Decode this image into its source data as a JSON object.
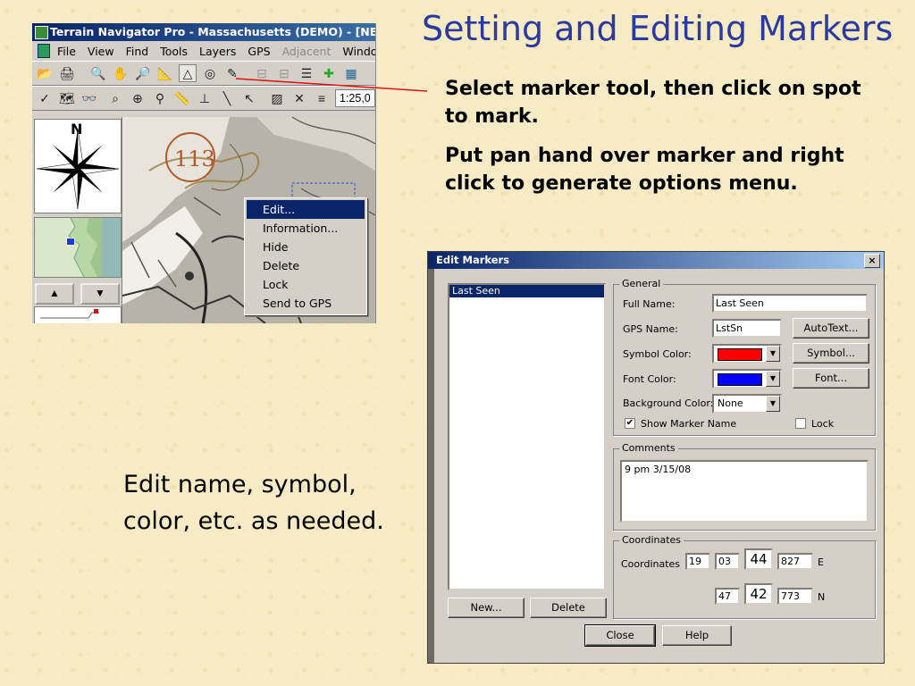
{
  "slide": {
    "title": "Setting and Editing Markers",
    "bullet1": "Select marker tool, then click on spot to mark.",
    "bullet2": "Put pan hand over marker and right click to generate options menu.",
    "edit_note": "Edit name, symbol, color, etc. as needed.",
    "accent_color": "#2a3aa0"
  },
  "terrain_navigator": {
    "window_title": "Terrain Navigator Pro - Massachusetts (DEMO) - [NE",
    "menu": [
      "File",
      "View",
      "Find",
      "Tools",
      "Layers",
      "GPS",
      "Adjacent",
      "Windo"
    ],
    "menu_disabled": "Adjacent",
    "scale_value": "1:25,0",
    "compass_label": "N",
    "road_marker": "113",
    "context_menu": {
      "items": [
        "Edit...",
        "Information...",
        "Hide",
        "Delete",
        "Lock",
        "Send to GPS"
      ],
      "selected": "Edit..."
    }
  },
  "edit_markers": {
    "title": "Edit Markers",
    "close_label": "×",
    "list_items": [
      "Last Seen"
    ],
    "new_button": "New...",
    "delete_button": "Delete",
    "general_label": "General",
    "full_name_label": "Full Name:",
    "full_name_value": "Last Seen",
    "gps_name_label": "GPS Name:",
    "gps_name_value": "LstSn",
    "autotext_button": "AutoText...",
    "symbol_color_label": "Symbol Color:",
    "symbol_color": "#ff0000",
    "symbol_button": "Symbol...",
    "font_color_label": "Font Color:",
    "font_color": "#0000ff",
    "font_button": "Font...",
    "background_color_label": "Background Color:",
    "background_color_value": "None",
    "show_name_label": "Show Marker Name",
    "show_name_checked": true,
    "lock_label": "Lock",
    "lock_checked": false,
    "comments_label": "Comments",
    "comments_value": "9 pm 3/15/08",
    "coordinates_group_label": "Coordinates",
    "coordinates_label": "Coordinates",
    "lon": {
      "deg": "19",
      "min": "03",
      "big": "44",
      "dec": "827",
      "dir": "E"
    },
    "lat": {
      "deg": "47",
      "big": "42",
      "dec": "773",
      "dir": "N"
    },
    "close_button": "Close",
    "help_button": "Help"
  }
}
